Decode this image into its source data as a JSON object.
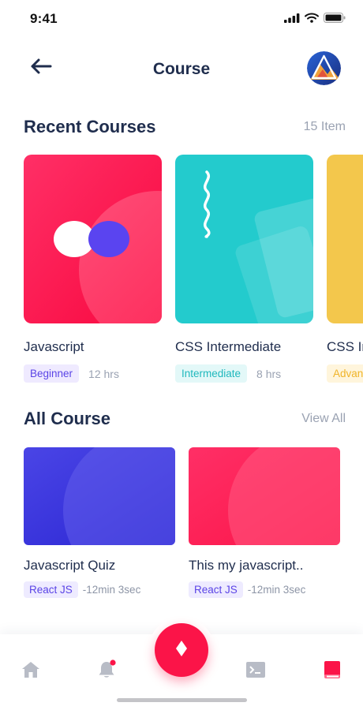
{
  "status": {
    "time": "9:41"
  },
  "header": {
    "title": "Course"
  },
  "recent": {
    "title": "Recent Courses",
    "count": "15 Item",
    "courses": [
      {
        "name": "Javascript",
        "level": "Beginner",
        "duration": "12 hrs",
        "level_bg": "#efeaff",
        "level_color": "#5a44e6",
        "theme_color": "#fb1448"
      },
      {
        "name": "CSS Intermediate",
        "level": "Intermediate",
        "duration": "8 hrs",
        "level_bg": "#e3f8f8",
        "level_color": "#1fb8bd",
        "theme_color": "#23cbcd"
      },
      {
        "name": "CSS Intermediate",
        "level": "Advanced",
        "duration": "",
        "level_bg": "#fff5dc",
        "level_color": "#f0b429",
        "theme_color": "#f3c74c"
      }
    ]
  },
  "all": {
    "title": "All Course",
    "link": "View All",
    "courses": [
      {
        "name": "Javascript Quiz",
        "tag": "React JS",
        "time": "-12min 3sec",
        "theme_color": "#3a35e0"
      },
      {
        "name": "This my javascript..",
        "tag": "React JS",
        "time": "-12min 3sec",
        "theme_color": "#fb1448"
      }
    ]
  },
  "nav": {
    "items": [
      {
        "icon": "home-icon"
      },
      {
        "icon": "bell-icon"
      },
      {
        "icon": "diamond-icon"
      },
      {
        "icon": "terminal-icon"
      },
      {
        "icon": "book-icon"
      }
    ],
    "accent": "#fb1448"
  }
}
